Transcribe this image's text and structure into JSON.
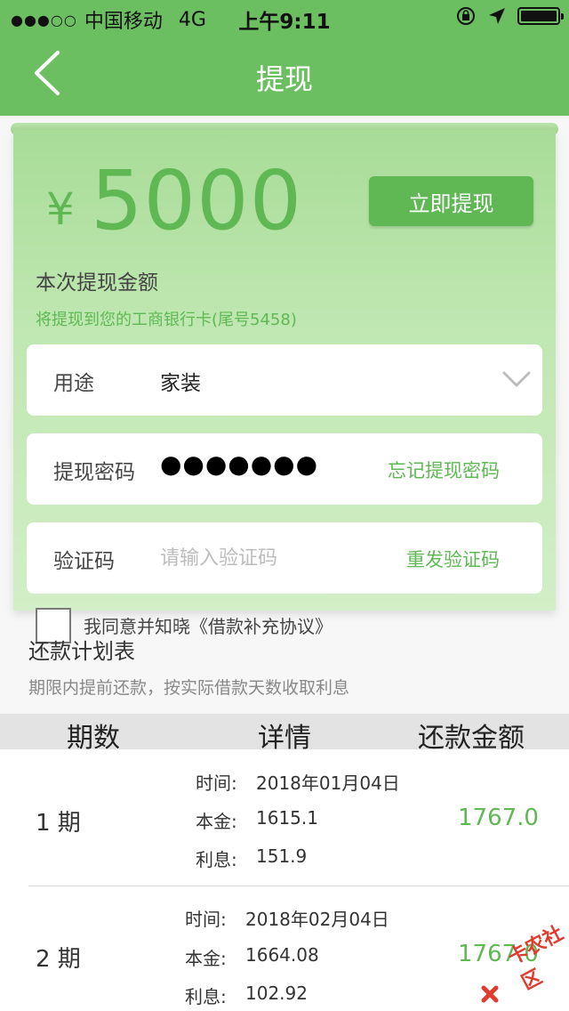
{
  "status_bar": {
    "carrier": "中国移动",
    "network": "4G",
    "time": "上午9:11"
  },
  "nav": {
    "title": "提现"
  },
  "withdraw": {
    "currency_symbol": "¥",
    "amount": "5000",
    "button_label": "立即提现",
    "amount_label": "本次提现金额",
    "bank_note": "将提现到您的工商银行卡(尾号5458)"
  },
  "form": {
    "purpose": {
      "label": "用途",
      "value": "家装"
    },
    "password": {
      "label": "提现密码",
      "masked": "●●●●●●●",
      "action": "忘记提现密码"
    },
    "code": {
      "label": "验证码",
      "placeholder": "请输入验证码",
      "action": "重发验证码"
    }
  },
  "agreement": {
    "text": "我同意并知晓《借款补充协议》",
    "checked": false
  },
  "plan": {
    "title": "还款计划表",
    "note": "期限内提前还款，按实际借款天数收取利息",
    "headers": [
      "期数",
      "详情",
      "还款金额"
    ],
    "rows": [
      {
        "period": "1 期",
        "time_label": "时间:",
        "time": "2018年01月04日",
        "principal_label": "本金:",
        "principal": "1615.1",
        "interest_label": "利息:",
        "interest": "151.9",
        "payment": "1767.0"
      },
      {
        "period": "2 期",
        "time_label": "时间:",
        "time": "2018年02月04日",
        "principal_label": "本金:",
        "principal": "1664.08",
        "interest_label": "利息:",
        "interest": "102.92",
        "payment": "1767.0"
      }
    ]
  },
  "watermark": {
    "text": "卡农社区"
  },
  "colors": {
    "brand_green": "#6cbf61",
    "accent_green": "#5fb854"
  }
}
